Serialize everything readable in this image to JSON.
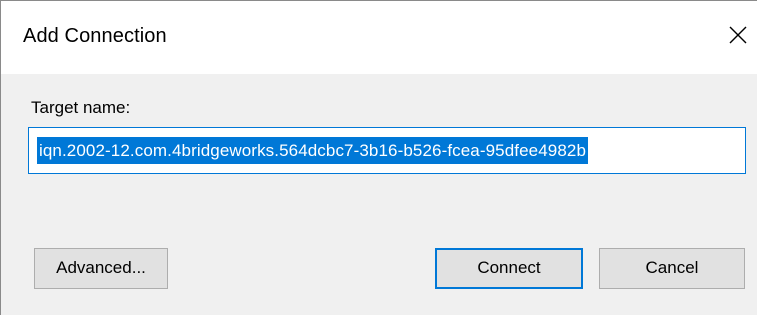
{
  "window": {
    "title": "Add Connection",
    "close_icon": "close-icon"
  },
  "form": {
    "target_label": "Target name:",
    "target_value": "iqn.2002-12.com.4bridgeworks.564dcbc7-3b16-b526-fcea-95dfee4982b"
  },
  "buttons": {
    "advanced": "Advanced...",
    "connect": "Connect",
    "cancel": "Cancel"
  },
  "colors": {
    "accent": "#0078d7",
    "dialog_bg": "#f0f0f0",
    "button_bg": "#e1e1e1"
  }
}
